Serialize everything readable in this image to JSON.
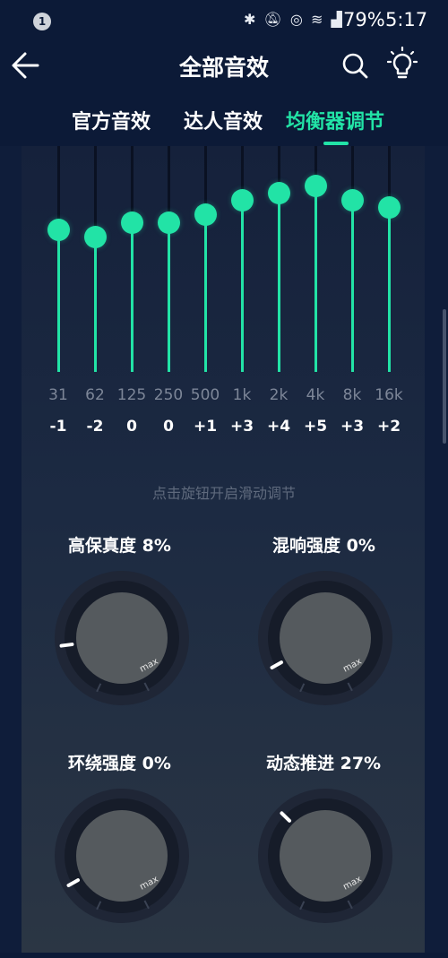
{
  "status_bar": {
    "notification_count": "1",
    "battery": "79%",
    "time": "5:17",
    "icons": [
      "bluetooth-icon",
      "mute-icon",
      "hotspot-icon",
      "wifi-icon",
      "5g-signal-icon"
    ]
  },
  "header": {
    "title": "全部音效"
  },
  "tabs": [
    {
      "label": "官方音效",
      "active": false
    },
    {
      "label": "达人音效",
      "active": false
    },
    {
      "label": "均衡器调节",
      "active": true
    }
  ],
  "equalizer": {
    "range": [
      -12,
      12
    ],
    "bands": [
      {
        "freq": "31",
        "gain": "-1",
        "value": -1
      },
      {
        "freq": "62",
        "gain": "-2",
        "value": -2
      },
      {
        "freq": "125",
        "gain": "0",
        "value": 0
      },
      {
        "freq": "250",
        "gain": "0",
        "value": 0
      },
      {
        "freq": "500",
        "gain": "+1",
        "value": 1
      },
      {
        "freq": "1k",
        "gain": "+3",
        "value": 3
      },
      {
        "freq": "2k",
        "gain": "+4",
        "value": 4
      },
      {
        "freq": "4k",
        "gain": "+5",
        "value": 5
      },
      {
        "freq": "8k",
        "gain": "+3",
        "value": 3
      },
      {
        "freq": "16k",
        "gain": "+2",
        "value": 2
      }
    ]
  },
  "hint": "点击旋钮开启滑动调节",
  "dials": [
    {
      "label": "高保真度 8%",
      "percent": 8,
      "max_label": "max"
    },
    {
      "label": "混响强度 0%",
      "percent": 0,
      "max_label": "max"
    },
    {
      "label": "环绕强度 0%",
      "percent": 0,
      "max_label": "max"
    },
    {
      "label": "动态推进 27%",
      "percent": 27,
      "max_label": "max"
    }
  ],
  "colors": {
    "accent": "#22e3a6",
    "background": "#0c1a37"
  }
}
